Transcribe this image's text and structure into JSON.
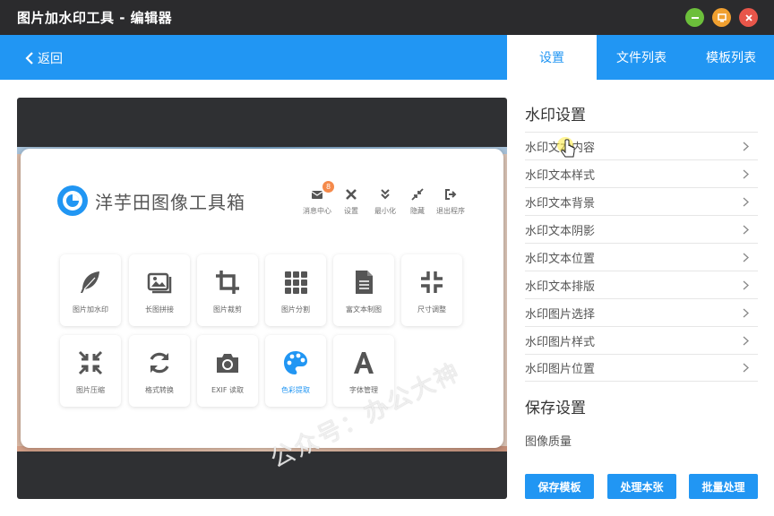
{
  "window": {
    "title": "图片加水印工具 - 编辑器"
  },
  "header": {
    "back_label": "返回",
    "tabs": [
      {
        "label": "设置",
        "active": true
      },
      {
        "label": "文件列表",
        "active": false
      },
      {
        "label": "模板列表",
        "active": false
      }
    ]
  },
  "preview": {
    "card_title": "洋芋田图像工具箱",
    "top_icons": [
      {
        "label": "消息中心",
        "icon": "mail-icon",
        "badge": "8"
      },
      {
        "label": "设置",
        "icon": "tools-icon"
      },
      {
        "label": "最小化",
        "icon": "chevrons-down-icon"
      },
      {
        "label": "隐藏",
        "icon": "collapse-arrows-icon"
      },
      {
        "label": "退出程序",
        "icon": "exit-icon"
      }
    ],
    "tools": [
      {
        "label": "图片加水印",
        "icon": "feather-icon"
      },
      {
        "label": "长图拼接",
        "icon": "images-icon"
      },
      {
        "label": "图片裁剪",
        "icon": "crop-icon"
      },
      {
        "label": "图片分割",
        "icon": "grid-icon"
      },
      {
        "label": "富文本制图",
        "icon": "document-icon"
      },
      {
        "label": "尺寸调整",
        "icon": "compress-icon"
      },
      {
        "label": "图片压缩",
        "icon": "shrink-icon"
      },
      {
        "label": "格式转换",
        "icon": "refresh-icon"
      },
      {
        "label": "EXIF 读取",
        "icon": "camera-icon"
      },
      {
        "label": "色彩提取",
        "icon": "palette-icon"
      },
      {
        "label": "字体管理",
        "icon": "font-icon"
      }
    ],
    "watermark_text": "公众号：办公大神"
  },
  "settings": {
    "watermark_title": "水印设置",
    "items": [
      "水印文本内容",
      "水印文本样式",
      "水印文本背景",
      "水印文本阴影",
      "水印文本位置",
      "水印文本排版",
      "水印图片选择",
      "水印图片样式",
      "水印图片位置"
    ],
    "save_title": "保存设置",
    "quality_label": "图像质量"
  },
  "actions": {
    "save_template": "保存模板",
    "process_one": "处理本张",
    "batch": "批量处理"
  },
  "colors": {
    "accent": "#2196f3",
    "titlebar": "#2b2b2d",
    "preview_bg": "#2f3033"
  }
}
